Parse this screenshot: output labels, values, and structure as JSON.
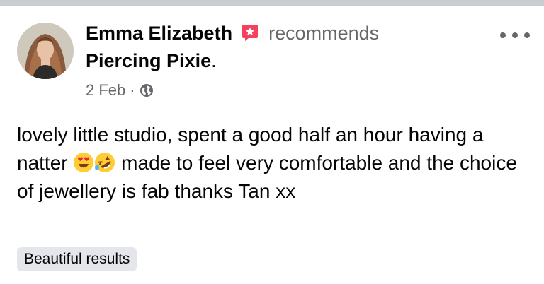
{
  "post": {
    "author": "Emma Elizabeth",
    "action": "recommends",
    "page_name": "Piercing Pixie",
    "page_suffix": ".",
    "date": "2 Feb",
    "separator": "·",
    "body_part1": "lovely little studio, spent a good half an hour having a natter ",
    "body_part2": " made to feel very comfortable and the choice of jewellery is fab thanks Tan xx",
    "tag": "Beautiful results"
  },
  "icons": {
    "recommend": "recommend-flag-icon",
    "audience": "globe-icon",
    "more": "more-options-icon",
    "emoji_1": "heart-eyes-emoji",
    "emoji_2": "rolling-laughing-emoji"
  },
  "colors": {
    "recommend_icon": "#f3425f",
    "secondary_text": "#65676b",
    "primary_text": "#050505",
    "tag_background": "#e4e6eb"
  }
}
